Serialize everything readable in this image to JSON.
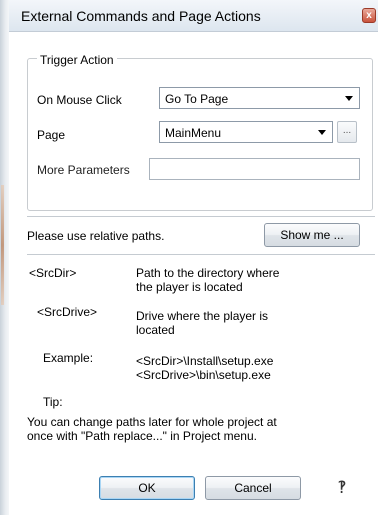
{
  "dialog": {
    "title": "External Commands and Page Actions",
    "close_label": "x"
  },
  "trigger_group": {
    "legend": "Trigger Action",
    "on_mouse_click_label": "On Mouse Click",
    "on_mouse_click_value": "Go To Page",
    "page_label": "Page",
    "page_value": "MainMenu",
    "browse_label": "...",
    "more_parameters_label": "More Parameters",
    "more_parameters_value": ""
  },
  "paths_hint": {
    "text": "Please use relative paths.",
    "show_me_label": "Show me ..."
  },
  "info": {
    "srcdir_key": "<SrcDir>",
    "srcdir_desc_1": "Path to the directory where",
    "srcdir_desc_2": "the player is located",
    "srcdrive_key": "<SrcDrive>",
    "srcdrive_desc_1": "Drive where the player is",
    "srcdrive_desc_2": "located",
    "example_key": "Example:",
    "example_1": "<SrcDir>\\Install\\setup.exe",
    "example_2": "<SrcDrive>\\bin\\setup.exe",
    "tip_label": "Tip:",
    "tip_1": "You can change paths later for whole project  at",
    "tip_2": "once with \"Path replace...\" in Project menu."
  },
  "buttons": {
    "ok_label": "OK",
    "cancel_label": "Cancel",
    "help_icon": "question-mark-icon"
  }
}
